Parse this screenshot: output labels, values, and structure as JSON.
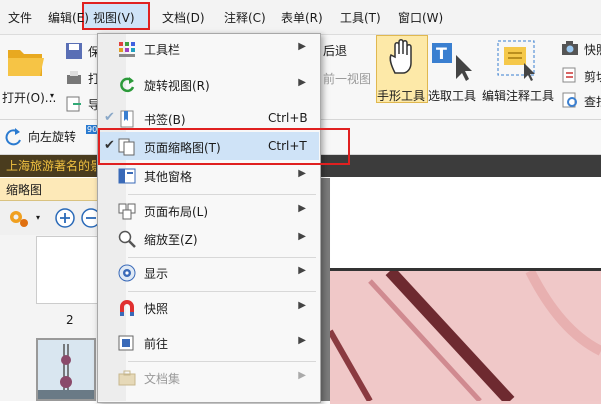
{
  "menubar": {
    "items": [
      "文件",
      "编辑(E)",
      "视图(V)",
      "文档(D)",
      "注释(C)",
      "表单(R)",
      "工具(T)",
      "窗口(W)"
    ]
  },
  "ribbon": {
    "open_label": "打开(O)...",
    "back_label": "后退",
    "prev_view_label": "前一视图",
    "hand_tool_label": "手形工具",
    "select_tool_label": "选取工具",
    "edit_annot_label": "编辑注释工具",
    "snapshot_label": "快照",
    "cut_label": "剪切",
    "find_label": "查找",
    "rotate_left_label": "向左旋转",
    "partial_save": "保",
    "partial_print": "打",
    "partial_export": "导",
    "rotate_badge": "90°"
  },
  "doc": {
    "tab_title": "上海旅游著名的景点",
    "thumb_panel_title": "缩略图",
    "thumb_page_number": "2"
  },
  "dropdown": {
    "items": [
      {
        "label": "工具栏",
        "shortcut": "",
        "submenu": true,
        "checked": false,
        "disabled": false,
        "icon": "toolbar-icon"
      },
      {
        "label": "旋转视图(R)",
        "shortcut": "",
        "submenu": true,
        "checked": false,
        "disabled": false,
        "icon": "rotate-view-icon"
      },
      {
        "label": "书签(B)",
        "shortcut": "Ctrl+B",
        "submenu": false,
        "checked": true,
        "disabled": false,
        "icon": "bookmark-icon"
      },
      {
        "label": "页面缩略图(T)",
        "shortcut": "Ctrl+T",
        "submenu": false,
        "checked": true,
        "disabled": false,
        "icon": "page-thumbnail-icon"
      },
      {
        "label": "其他窗格",
        "shortcut": "",
        "submenu": true,
        "checked": false,
        "disabled": false,
        "icon": "other-panes-icon"
      },
      {
        "label": "页面布局(L)",
        "shortcut": "",
        "submenu": true,
        "checked": false,
        "disabled": false,
        "icon": "page-layout-icon"
      },
      {
        "label": "缩放至(Z)",
        "shortcut": "",
        "submenu": true,
        "checked": false,
        "disabled": false,
        "icon": "zoom-icon"
      },
      {
        "label": "显示",
        "shortcut": "",
        "submenu": true,
        "checked": false,
        "disabled": false,
        "icon": "display-eye-icon"
      },
      {
        "label": "快照",
        "shortcut": "",
        "submenu": true,
        "checked": false,
        "disabled": false,
        "icon": "snapshot-magnet-icon"
      },
      {
        "label": "前往",
        "shortcut": "",
        "submenu": true,
        "checked": false,
        "disabled": false,
        "icon": "go-to-icon"
      },
      {
        "label": "文档集",
        "shortcut": "",
        "submenu": true,
        "checked": false,
        "disabled": true,
        "icon": "doc-set-icon"
      }
    ]
  },
  "colors": {
    "highlight": "#cfe3f7",
    "annotation_red": "#e02020",
    "doc_tab_text": "#f0c040",
    "thumb_header": "#fde9b8"
  }
}
